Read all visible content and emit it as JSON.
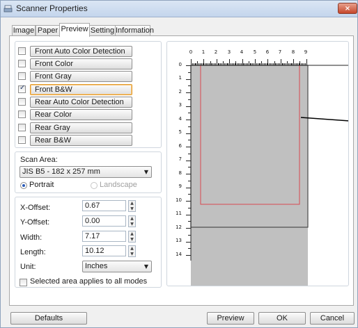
{
  "window": {
    "title": "Scanner Properties",
    "close_glyph": "×"
  },
  "tabs": [
    {
      "label": "Image"
    },
    {
      "label": "Paper"
    },
    {
      "label": "Preview"
    },
    {
      "label": "Setting"
    },
    {
      "label": "Information"
    }
  ],
  "active_tab": "Preview",
  "modes": [
    {
      "label": "Front Auto Color Detection",
      "checked": false,
      "selected": false
    },
    {
      "label": "Front Color",
      "checked": false,
      "selected": false
    },
    {
      "label": "Front Gray",
      "checked": false,
      "selected": false
    },
    {
      "label": "Front B&W",
      "checked": true,
      "selected": true
    },
    {
      "label": "Rear Auto Color Detection",
      "checked": false,
      "selected": false
    },
    {
      "label": "Rear Color",
      "checked": false,
      "selected": false
    },
    {
      "label": "Rear Gray",
      "checked": false,
      "selected": false
    },
    {
      "label": "Rear B&W",
      "checked": false,
      "selected": false
    }
  ],
  "scan_area": {
    "label": "Scan Area:",
    "value": "JIS B5 - 182 x 257 mm",
    "portrait_label": "Portrait",
    "landscape_label": "Landscape",
    "orientation": "Portrait"
  },
  "offsets": {
    "x_label": "X-Offset:",
    "x_value": "0.67",
    "y_label": "Y-Offset:",
    "y_value": "0.00",
    "width_label": "Width:",
    "width_value": "7.17",
    "length_label": "Length:",
    "length_value": "10.12",
    "unit_label": "Unit:",
    "unit_value": "Inches"
  },
  "apply_all": {
    "label": "Selected area applies to all modes",
    "checked": false
  },
  "ruler": {
    "horizontal": [
      "0",
      "1",
      "2",
      "3",
      "4",
      "5",
      "6",
      "7",
      "8",
      "9"
    ],
    "vertical": [
      "0",
      "1",
      "2",
      "3",
      "4",
      "5",
      "6",
      "7",
      "8",
      "9",
      "10",
      "11",
      "12",
      "13",
      "14"
    ]
  },
  "buttons": {
    "defaults": "Defaults",
    "preview": "Preview",
    "ok": "OK",
    "cancel": "Cancel"
  },
  "colors": {
    "selection_border": "#d9484f",
    "preview_gray": "#c0c0c0",
    "focus_orange": "#e39a2a",
    "radio_dot": "#2a5bb8"
  }
}
